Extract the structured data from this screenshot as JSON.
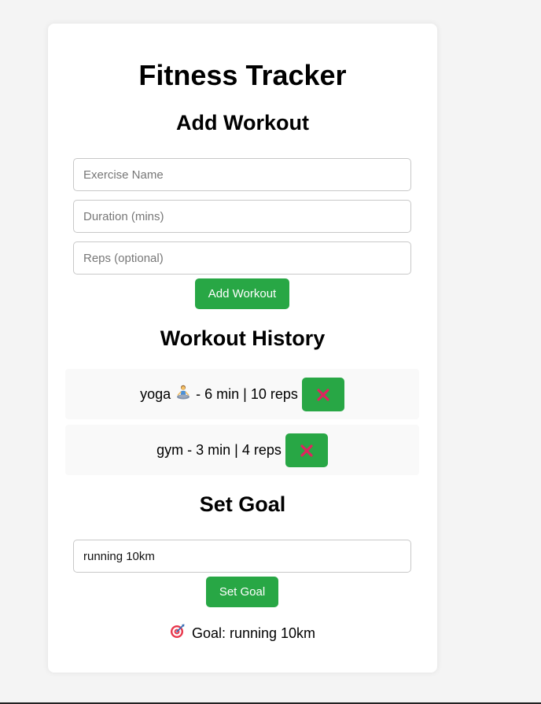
{
  "app": {
    "title": "Fitness Tracker"
  },
  "add_workout": {
    "heading": "Add Workout",
    "exercise_placeholder": "Exercise Name",
    "duration_placeholder": "Duration (mins)",
    "reps_placeholder": "Reps (optional)",
    "button_label": "Add Workout"
  },
  "history": {
    "heading": "Workout History",
    "items": [
      {
        "name": "yoga",
        "icon": "person-in-lotus-position-icon",
        "detail": "- 6 min | 10 reps",
        "delete_icon": "cross-mark-icon"
      },
      {
        "name": "gym",
        "icon": "",
        "detail": "- 3 min | 4 reps",
        "delete_icon": "cross-mark-icon"
      }
    ]
  },
  "goal": {
    "heading": "Set Goal",
    "input_value": "running 10km",
    "button_label": "Set Goal",
    "status_icon": "direct-hit-target-icon",
    "status_text": "Goal: running 10km"
  },
  "colors": {
    "accent": "#28a745",
    "delete_cross": "#e0245e",
    "page_background": "#f4f4f4",
    "card_background": "#ffffff",
    "row_background": "#f9f9f9"
  }
}
